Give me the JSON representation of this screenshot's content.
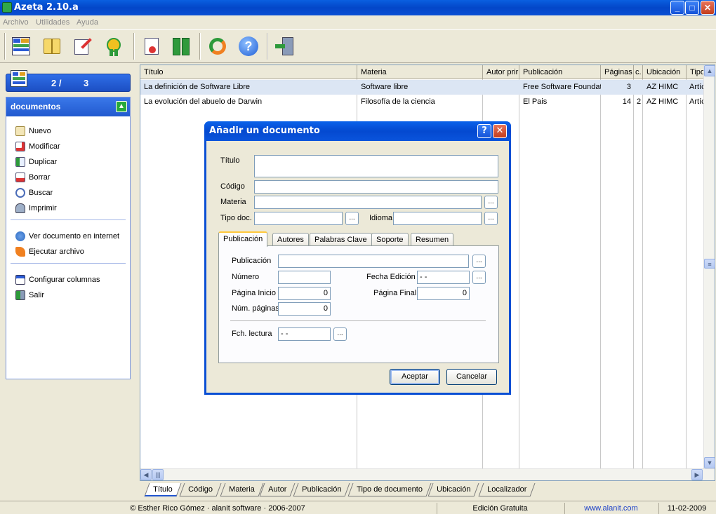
{
  "window": {
    "title": "Azeta 2.10.a"
  },
  "menu": [
    "Archivo",
    "Utilidades",
    "Ayuda"
  ],
  "toolbar": [
    "table-grid-icon",
    "book-icon",
    "edit-pen-icon",
    "badge-icon",
    "certificate-icon",
    "binders-icon",
    "refresh-icon",
    "help-icon",
    "exit-door-icon"
  ],
  "counter": {
    "current": "2 /",
    "total": "3"
  },
  "sidebar": {
    "title": "documentos",
    "items": [
      {
        "label": "Nuevo",
        "icon": "new-doc-icon"
      },
      {
        "label": "Modificar",
        "icon": "edit-icon"
      },
      {
        "label": "Duplicar",
        "icon": "duplicate-icon"
      },
      {
        "label": "Borrar",
        "icon": "delete-icon"
      },
      {
        "label": "Buscar",
        "icon": "search-icon"
      },
      {
        "label": "Imprimir",
        "icon": "print-icon"
      },
      {
        "label": "Ver documento en internet",
        "icon": "globe-icon"
      },
      {
        "label": "Ejecutar archivo",
        "icon": "run-icon"
      },
      {
        "label": "Configurar columnas",
        "icon": "columns-icon"
      },
      {
        "label": "Salir",
        "icon": "exit-icon"
      }
    ]
  },
  "grid": {
    "columns": [
      "Título",
      "Materia",
      "Autor prir",
      "Publicación",
      "Páginas",
      "c.",
      "Ubicación",
      "Tipo"
    ],
    "rows": [
      [
        "La definición de Software Libre",
        "Software libre",
        "",
        "Free Software Foundat",
        "3",
        "",
        "AZ HIMC",
        "Artíc"
      ],
      [
        "La evolución del abuelo de Darwin",
        "Filosofía de la ciencia",
        "",
        "El Pais",
        "14",
        "2",
        "AZ HIMC",
        "Artíc"
      ]
    ]
  },
  "bottom_tabs": [
    "Título",
    "Código",
    "Materia",
    "Autor",
    "Publicación",
    "Tipo de documento",
    "Ubicación",
    "Localizador"
  ],
  "status": {
    "copyright": "© Esther Rico Gómez · alanit software · 2006-2007",
    "edition": "Edición Gratuita",
    "url": "www.alanit.com",
    "date": "11-02-2009"
  },
  "dialog": {
    "title": "Añadir un documento",
    "labels": {
      "titulo": "Título",
      "codigo": "Código",
      "materia": "Materia",
      "tipo_doc": "Tipo doc.",
      "idioma": "Idioma",
      "publicacion": "Publicación",
      "numero": "Número",
      "fecha_edicion": "Fecha Edición",
      "pagina_inicio": "Página Inicio",
      "pagina_final": "Página Final",
      "num_paginas": "Núm. páginas",
      "fch_lectura": "Fch. lectura"
    },
    "values": {
      "fecha_edicion": " -  - ",
      "pagina_inicio": "0",
      "pagina_final": "0",
      "num_paginas": "0",
      "fch_lectura": " -  - "
    },
    "browse": "...",
    "tabs": [
      "Publicación",
      "Autores",
      "Palabras Clave",
      "Soporte",
      "Resumen"
    ],
    "buttons": {
      "accept": "Aceptar",
      "cancel": "Cancelar"
    }
  }
}
